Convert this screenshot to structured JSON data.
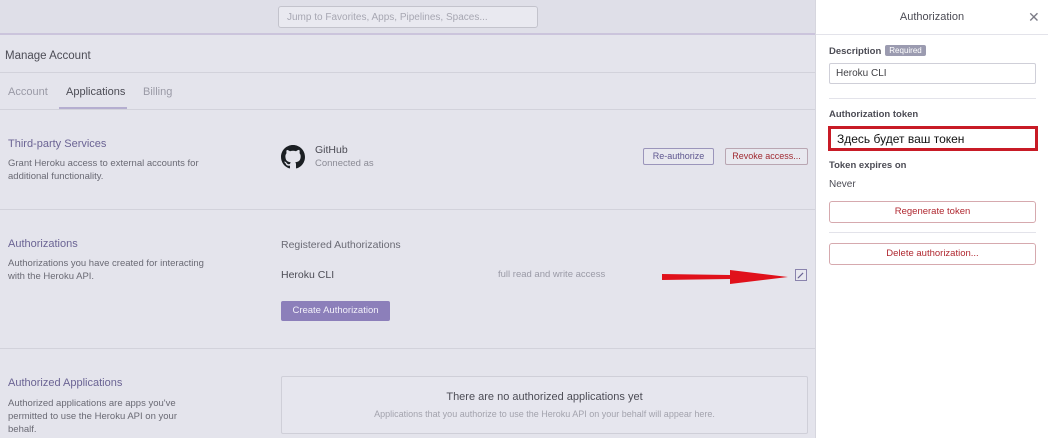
{
  "topbar": {
    "search_placeholder": "Jump to Favorites, Apps, Pipelines, Spaces..."
  },
  "page": {
    "title": "Manage Account"
  },
  "tabs": [
    {
      "label": "Account",
      "active": false
    },
    {
      "label": "Applications",
      "active": true
    },
    {
      "label": "Billing",
      "active": false
    }
  ],
  "third_party": {
    "title": "Third-party Services",
    "description": "Grant Heroku access to external accounts for additional functionality.",
    "provider_name": "GitHub",
    "provider_status": "Connected as",
    "reauthorize_label": "Re-authorize",
    "revoke_label": "Revoke access..."
  },
  "authorizations": {
    "title": "Authorizations",
    "description": "Authorizations you have created for interacting with the Heroku API.",
    "registered_title": "Registered Authorizations",
    "items": [
      {
        "name": "Heroku CLI",
        "scope": "full read and write access"
      }
    ],
    "create_label": "Create Authorization"
  },
  "authorized_apps": {
    "title": "Authorized Applications",
    "description": "Authorized applications are apps you've permitted to use the Heroku API on your behalf.",
    "empty_title": "There are no authorized applications yet",
    "empty_subtitle": "Applications that you authorize to use the Heroku API on your behalf will appear here."
  },
  "drawer": {
    "title": "Authorization",
    "description_label": "Description",
    "required_badge": "Required",
    "description_value": "Heroku CLI",
    "token_label": "Authorization token",
    "token_value": "Здесь будет ваш токен",
    "expires_label": "Token expires on",
    "expires_value": "Never",
    "regenerate_label": "Regenerate token",
    "delete_label": "Delete authorization..."
  },
  "colors": {
    "accent": "#8c7fba",
    "danger": "#b02830",
    "annotation": "#c81b26"
  }
}
